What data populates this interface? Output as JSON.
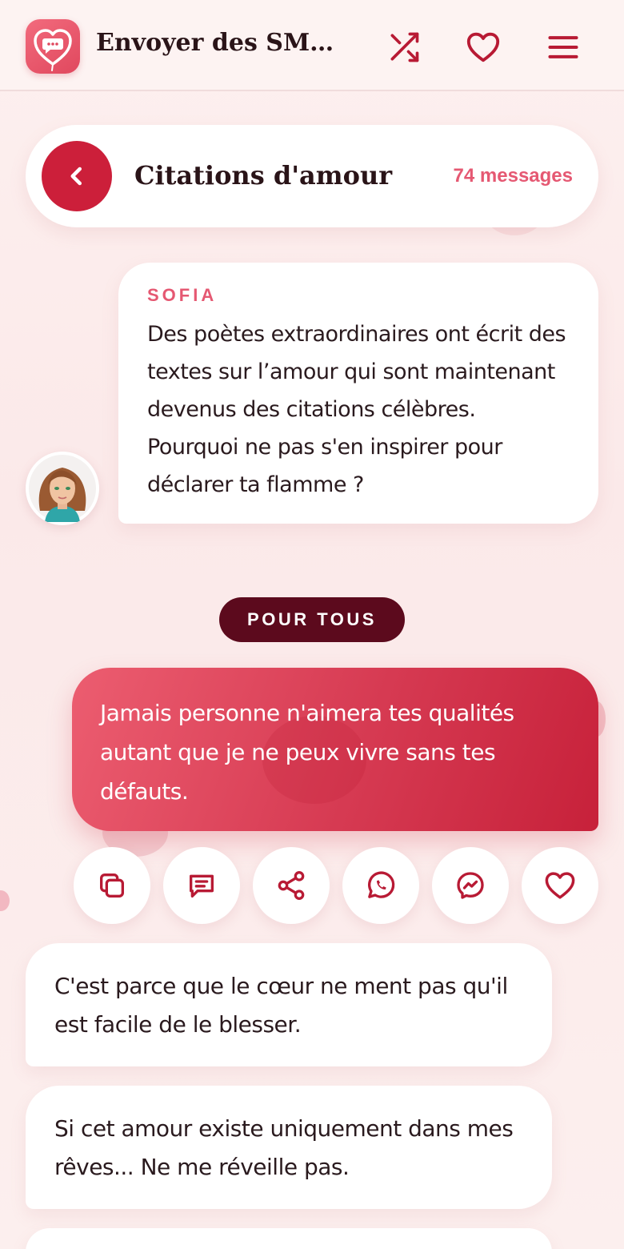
{
  "header": {
    "title": "Envoyer des SMS d'amour",
    "icons": [
      "chat-heart-logo-icon",
      "shuffle-icon",
      "heart-icon",
      "hamburger-menu-icon"
    ]
  },
  "category": {
    "title": "Citations d'amour",
    "count": "74 messages"
  },
  "intro": {
    "author": "SOFIA",
    "text": "Des poètes extraordinaires ont écrit des textes sur l’amour qui sont maintenant devenus des citations célèbres. Pourquoi ne pas s'en inspirer pour déclarer ta flamme ?"
  },
  "section": {
    "label": "POUR TOUS"
  },
  "featured": {
    "text": "Jamais personne n'aimera tes qualités autant que je ne peux vivre sans tes défauts."
  },
  "actions": [
    "copy-icon",
    "sms-icon",
    "share-icon",
    "whatsapp-icon",
    "messenger-icon",
    "heart-icon"
  ],
  "messages": [
    {
      "text": "C'est parce que le cœur ne ment pas qu'il est facile de le blesser."
    },
    {
      "text": "Si cet amour existe uniquement dans mes rêves... Ne me réveille pas."
    },
    {
      "text": ""
    }
  ],
  "colors": {
    "accent": "#cc1f3a",
    "accent_light": "#e55872",
    "dark_pill": "#5c0a1d",
    "background": "#fdf0ef"
  }
}
